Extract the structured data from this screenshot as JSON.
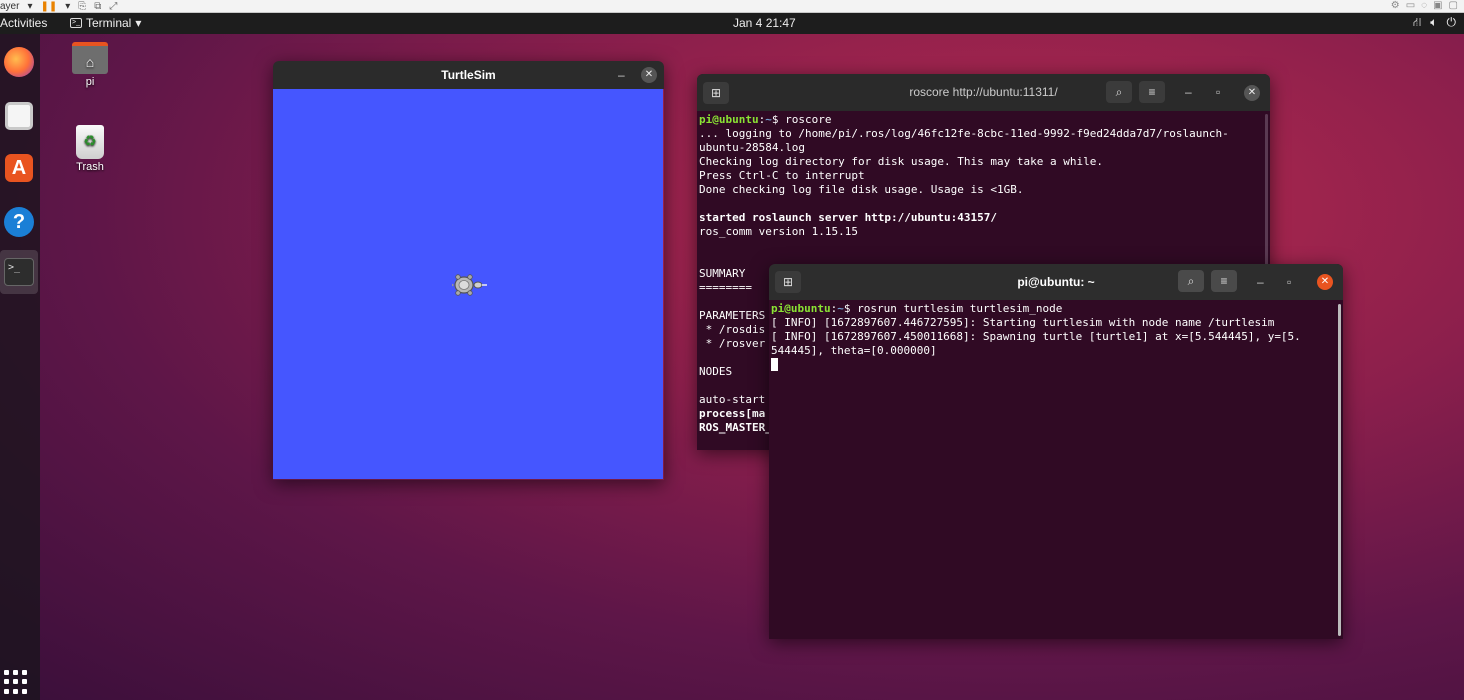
{
  "vm_toolbar": {
    "player_label": "ayer"
  },
  "topbar": {
    "activities": "Activities",
    "app_menu_label": "Terminal",
    "clock": "Jan 4  21:47"
  },
  "desktop": {
    "home_label": "pi",
    "trash_label": "Trash"
  },
  "turtlesim_window": {
    "title": "TurtleSim",
    "background_color": "#4556ff"
  },
  "roscore_window": {
    "title": "roscore http://ubuntu:11311/",
    "lines": [
      {
        "user": "pi@ubuntu",
        "path": "~",
        "cmd": "roscore"
      },
      "... logging to /home/pi/.ros/log/46fc12fe-8cbc-11ed-9992-f9ed24dda7d7/roslaunch-",
      "ubuntu-28584.log",
      "Checking log directory for disk usage. This may take a while.",
      "Press Ctrl-C to interrupt",
      "Done checking log file disk usage. Usage is <1GB.",
      "",
      "started roslaunch server http://ubuntu:43157/",
      "ros_comm version 1.15.15",
      "",
      "",
      "SUMMARY",
      "========",
      "",
      "PARAMETERS",
      " * /rosdis",
      " * /rosver",
      "",
      "NODES",
      "",
      "auto-start",
      "process[ma",
      "ROS_MASTER_"
    ]
  },
  "turtle_term_window": {
    "title": "pi@ubuntu: ~",
    "lines": [
      {
        "user": "pi@ubuntu",
        "path": "~",
        "cmd": "rosrun turtlesim turtlesim_node"
      },
      "[ INFO] [1672897607.446727595]: Starting turtlesim with node name /turtlesim",
      "[ INFO] [1672897607.450011668]: Spawning turtle [turtle1] at x=[5.544445], y=[5.",
      "544445], theta=[0.000000]"
    ]
  },
  "colors": {
    "terminal_bg": "#300a24",
    "prompt_user": "#8ae234",
    "prompt_path": "#729fcf",
    "accent": "#e95420"
  }
}
